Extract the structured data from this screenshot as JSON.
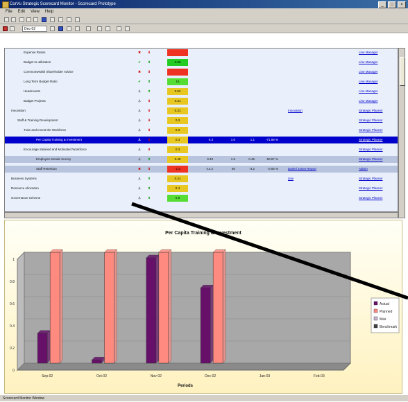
{
  "window": {
    "title": "CorVu Strategic Scorecard Monitor - Scorecard Prototype"
  },
  "menu": [
    "File",
    "Edit",
    "View",
    "Help"
  ],
  "toolbar": {
    "period_value": "Dec-02"
  },
  "rows": [
    {
      "indent": 3,
      "label": "Expense Ratios",
      "ic1": "✖",
      "ic2": "⬇",
      "score": "",
      "color": "#ee3322",
      "v": [
        "",
        "",
        "",
        ""
      ],
      "link1": "",
      "owner": "Line Manager",
      "style": ""
    },
    {
      "indent": 3,
      "label": "Budget to utilization",
      "ic1": "✔",
      "ic2": "⬆",
      "score": "0.65",
      "color": "#22cc22",
      "v": [
        "",
        "",
        "",
        ""
      ],
      "link1": "",
      "owner": "Line Manager",
      "style": ""
    },
    {
      "indent": 3,
      "label": "Commonwealth Shareholder Advice",
      "ic1": "✖",
      "ic2": "⬇",
      "score": "",
      "color": "#ee3322",
      "v": [
        "",
        "",
        "",
        ""
      ],
      "link1": "",
      "owner": "Line Manager",
      "style": ""
    },
    {
      "indent": 3,
      "label": "Long Term Budget Ratio",
      "ic1": "✔",
      "ic2": "⬆",
      "score": "16",
      "color": "#55dd33",
      "v": [
        "",
        "",
        "",
        ""
      ],
      "link1": "",
      "owner": "Line Manager",
      "style": ""
    },
    {
      "indent": 3,
      "label": "Headcounts",
      "ic1": "♙",
      "ic2": "⬆",
      "score": "0.52",
      "color": "#e8c820",
      "v": [
        "",
        "",
        "",
        ""
      ],
      "link1": "",
      "owner": "Line Manager",
      "style": ""
    },
    {
      "indent": 3,
      "label": "Budget Projects",
      "ic1": "♙",
      "ic2": "⬇",
      "score": "0.31",
      "color": "#e8c820",
      "v": [
        "",
        "",
        "",
        ""
      ],
      "link1": "",
      "owner": "Line Manager",
      "style": ""
    },
    {
      "indent": 1,
      "label": "Innovation",
      "ic1": "♙",
      "ic2": "⬇",
      "score": "0.31",
      "color": "#e8c820",
      "v": [
        "",
        "",
        "",
        ""
      ],
      "link1": "Innovation",
      "owner": "Strategic Planner",
      "style": ""
    },
    {
      "indent": 2,
      "label": "Staff & Training Development",
      "ic1": "♙",
      "ic2": "⬇",
      "score": "0.3",
      "color": "#e8c820",
      "v": [
        "",
        "",
        "",
        ""
      ],
      "link1": "",
      "owner": "Strategic Planner",
      "style": ""
    },
    {
      "indent": 3,
      "label": "Train and Invest the Workforce",
      "ic1": "♙",
      "ic2": "⬇",
      "score": "0.3",
      "color": "#e8c820",
      "v": [
        "",
        "",
        "",
        ""
      ],
      "link1": "",
      "owner": "Strategic Planner",
      "style": ""
    },
    {
      "indent": 5,
      "label": "Per Capita Training & Investment",
      "ic1": "♙",
      "ic2": "⬇",
      "score": "0.3",
      "color": "#e8c820",
      "v": [
        "0.3",
        "1.0",
        "1.1",
        "-71.56 %"
      ],
      "link1": "",
      "owner": "Strategic Planner",
      "style": "sel"
    },
    {
      "indent": 3,
      "label": "Encourage Salaried and Motivated Workforce",
      "ic1": "♙",
      "ic2": "⬇",
      "score": "0.3",
      "color": "#e8c820",
      "v": [
        "",
        "",
        "",
        ""
      ],
      "link1": "",
      "owner": "Strategic Planner",
      "style": ""
    },
    {
      "indent": 5,
      "label": "Employee Morale Survey",
      "ic1": "♙",
      "ic2": "⬆",
      "score": "0.49",
      "color": "#e8c820",
      "v": [
        "0.49",
        "1.5",
        "0.45",
        "60.67 %"
      ],
      "link1": "",
      "owner": "Strategic Planner",
      "style": "alt"
    },
    {
      "indent": 5,
      "label": "Staff Retention",
      "ic1": "✖",
      "ic2": "⬇",
      "score": "-1.5",
      "color": "#ee3322",
      "v": [
        "-14.2",
        "80",
        "-3.2",
        "-0.05 %"
      ],
      "link1": "Daniel Jones Report",
      "owner": "Admin",
      "style": "alt"
    },
    {
      "indent": 1,
      "label": "Business Systems",
      "ic1": "♙",
      "ic2": "⬆",
      "score": "0.41",
      "color": "#e8c820",
      "v": [
        "",
        "",
        "",
        ""
      ],
      "link1": "Use",
      "owner": "Strategic Planner",
      "style": ""
    },
    {
      "indent": 1,
      "label": "Resource Allocation",
      "ic1": "♙",
      "ic2": "⬆",
      "score": "0.4",
      "color": "#e8c820",
      "v": [
        "",
        "",
        "",
        ""
      ],
      "link1": "",
      "owner": "Strategic Planner",
      "style": ""
    },
    {
      "indent": 1,
      "label": "Governance Scheme",
      "ic1": "♙",
      "ic2": "⬆",
      "score": "0.9",
      "color": "#55dd33",
      "v": [
        "",
        "",
        "",
        ""
      ],
      "link1": "",
      "owner": "Strategic Planner",
      "style": ""
    }
  ],
  "chart_data": {
    "type": "bar",
    "title": "Per Capita Training & Investment",
    "xlabel": "Periods",
    "ylabel": "",
    "ylim": [
      0,
      1
    ],
    "yticks": [
      "0",
      "0.2",
      "0.4",
      "0.6",
      "0.8",
      "1"
    ],
    "categories": [
      "Sep-02",
      "Oct-02",
      "Nov-02",
      "Dec-02",
      "Jan-03",
      "Feb-03"
    ],
    "series": [
      {
        "name": "Actual",
        "color": "#66106a",
        "values": [
          0.27,
          0.03,
          0.95,
          0.68,
          0,
          0
        ]
      },
      {
        "name": "Planned",
        "color": "#ff8a80",
        "values": [
          1.0,
          1.0,
          1.0,
          1.0,
          0,
          0
        ]
      },
      {
        "name": "Max",
        "color": "#c8b4d0",
        "values": [
          0,
          0,
          0,
          0,
          0,
          0
        ]
      },
      {
        "name": "Benchmark",
        "color": "#404040",
        "values": [
          0,
          0,
          0,
          0,
          0,
          0
        ]
      }
    ]
  },
  "status": "Scorecard Monitor Window"
}
